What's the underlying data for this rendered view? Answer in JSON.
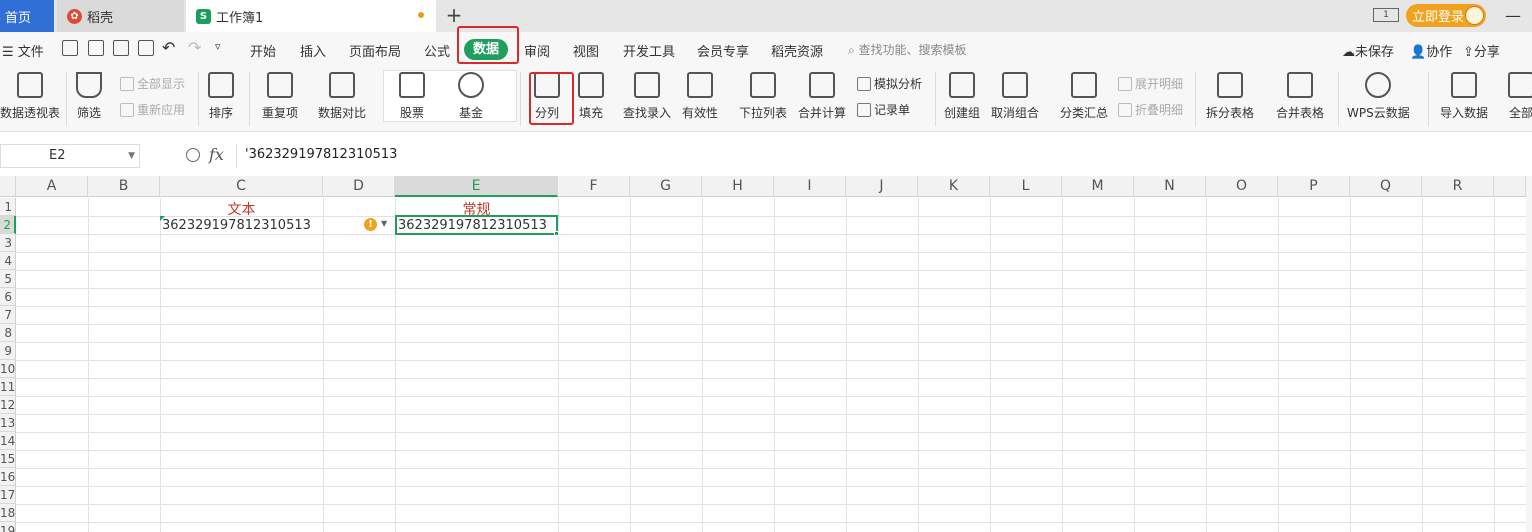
{
  "tabbar": {
    "home": "首页",
    "daoke": "稻壳",
    "workbook": "工作簿1",
    "book_logo": "S",
    "new_tab": "+",
    "layout_badge": "1",
    "login": "立即登录",
    "minimize": "—"
  },
  "menu": {
    "file": "☰ 文件",
    "items": [
      "开始",
      "插入",
      "页面布局",
      "公式",
      "数据",
      "审阅",
      "视图",
      "开发工具",
      "会员专享",
      "稻壳资源"
    ],
    "search": "查找功能、搜索模板",
    "unsaved": "未保存",
    "collab": "协作",
    "share": "分享"
  },
  "ribbon": {
    "pivot": "数据透视表",
    "filter": "筛选",
    "show_all": "全部显示",
    "reapply": "重新应用",
    "sort": "排序",
    "duplicates": "重复项",
    "compare": "数据对比",
    "stocks": "股票",
    "funds": "基金",
    "split": "分列",
    "fill": "填充",
    "lookup": "查找录入",
    "validity": "有效性",
    "dropdown": "下拉列表",
    "consolidate": "合并计算",
    "whatif": "模拟分析",
    "record": "记录单",
    "group": "创建组",
    "ungroup": "取消组合",
    "subtotal": "分类汇总",
    "expand": "展开明细",
    "collapse": "折叠明细",
    "split_table": "拆分表格",
    "merge_table": "合并表格",
    "wps_cloud": "WPS云数据",
    "import": "导入数据",
    "all": "全部"
  },
  "formula": {
    "name_box": "E2",
    "fx": "fx",
    "content": "'362329197812310513"
  },
  "grid": {
    "columns": [
      "A",
      "B",
      "C",
      "D",
      "E",
      "F",
      "G",
      "H",
      "I",
      "J",
      "K",
      "L",
      "M",
      "N",
      "O",
      "P",
      "Q",
      "R"
    ],
    "rows": [
      "1",
      "2",
      "3",
      "4",
      "5",
      "6",
      "7",
      "8",
      "9",
      "10",
      "11",
      "12",
      "13",
      "14",
      "15",
      "16",
      "17",
      "18",
      "19"
    ],
    "c1": "文本",
    "e1": "常规",
    "c2": "362329197812310513",
    "e2": "362329197812310513",
    "warn": "!"
  }
}
